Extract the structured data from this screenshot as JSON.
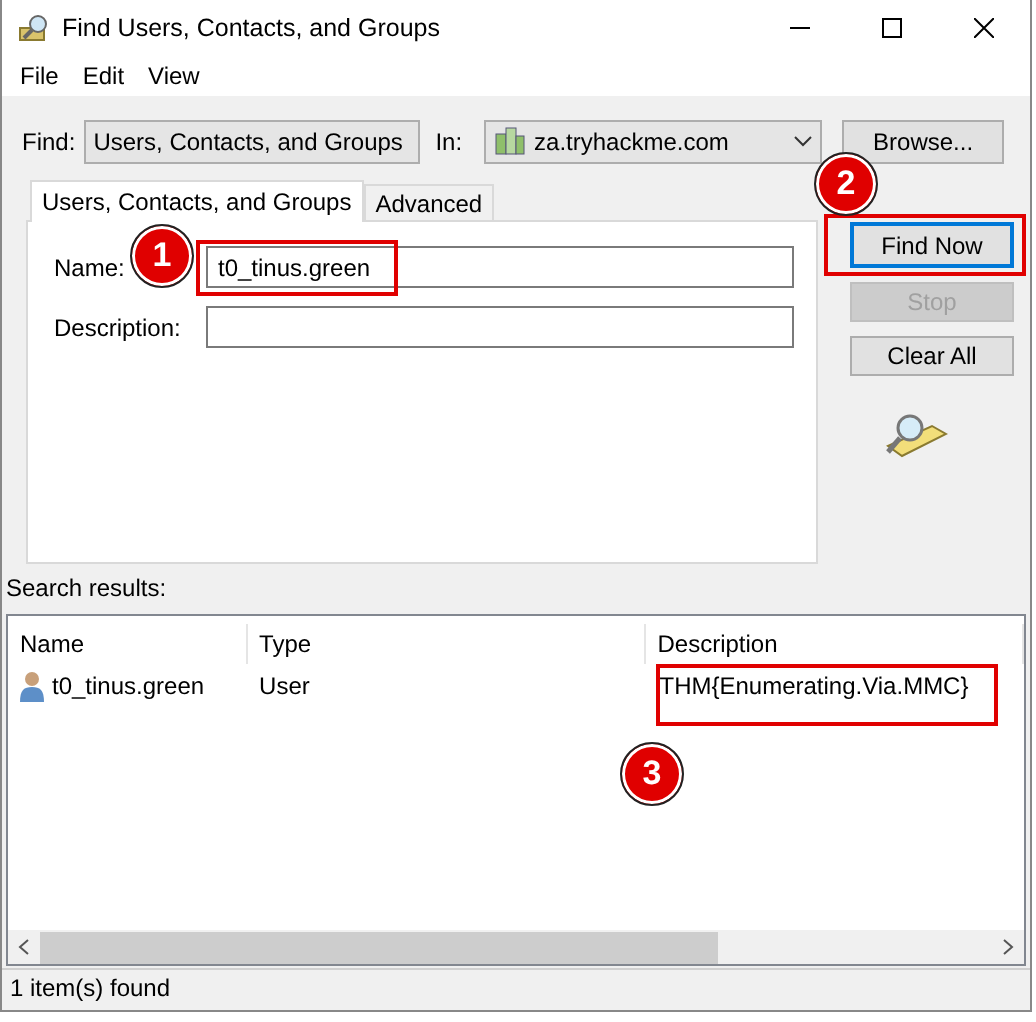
{
  "window": {
    "title": "Find Users, Contacts, and Groups"
  },
  "menu": [
    "File",
    "Edit",
    "View"
  ],
  "find": {
    "label": "Find:",
    "value": "Users, Contacts, and Groups"
  },
  "in": {
    "label": "In:",
    "value": "za.tryhackme.com"
  },
  "browse_button": "Browse...",
  "tabs": [
    {
      "label": "Users, Contacts, and Groups",
      "selected": true
    },
    {
      "label": "Advanced",
      "selected": false
    }
  ],
  "fields": [
    {
      "label": "Name:",
      "value": "t0_tinus.green"
    },
    {
      "label": "Description:"
    }
  ],
  "buttons": [
    {
      "label": "Find Now",
      "focused": true,
      "disabled": false
    },
    {
      "label": "Stop",
      "focused": false,
      "disabled": true
    },
    {
      "label": "Clear All",
      "focused": false,
      "disabled": false
    }
  ],
  "search_results_label": "Search results:",
  "results": {
    "columns": [
      "Name",
      "Type",
      "Description"
    ],
    "rows": [
      {
        "name": "t0_tinus.green",
        "type": "User",
        "description": "THM{Enumerating.Via.MMC}"
      }
    ]
  },
  "status_bar": "1 item(s) found",
  "annotations": [
    {
      "number": "1"
    },
    {
      "number": "2"
    },
    {
      "number": "3"
    }
  ]
}
